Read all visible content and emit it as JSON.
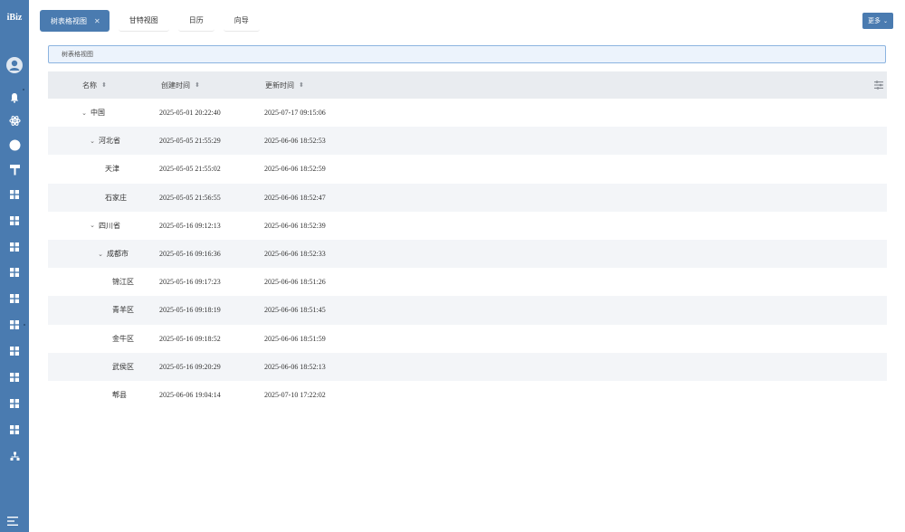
{
  "sidebar": {
    "brand": "iBiz",
    "icons": [
      "user-avatar-icon",
      "bell-icon",
      "atom-icon",
      "circle-icon",
      "hammer-icon",
      "grid-icon",
      "grid-icon",
      "grid-icon",
      "grid-icon",
      "grid-icon",
      "grid-icon",
      "grid-icon",
      "grid-icon",
      "grid-icon",
      "grid-icon",
      "sitemap-icon",
      "menu-toggle-icon"
    ]
  },
  "tabs": [
    {
      "label": "树表格视图",
      "active": true,
      "closable": true
    },
    {
      "label": "甘特视图",
      "active": false
    },
    {
      "label": "日历",
      "active": false
    },
    {
      "label": "向导",
      "active": false
    }
  ],
  "toolbar": {
    "more_label": "更多"
  },
  "breadcrumb": {
    "label": "树表格视图"
  },
  "grid": {
    "columns": {
      "name": "名称",
      "created": "创建时间",
      "updated": "更新时间"
    },
    "rows": [
      {
        "name": "中国",
        "expanded": true,
        "level": 0,
        "has_children": true,
        "created": "2025-05-01 20:22:40",
        "updated": "2025-07-17 09:15:06"
      },
      {
        "name": "河北省",
        "expanded": true,
        "level": 1,
        "has_children": true,
        "created": "2025-05-05 21:55:29",
        "updated": "2025-06-06 18:52:53"
      },
      {
        "name": "天津",
        "level": 2,
        "has_children": false,
        "created": "2025-05-05 21:55:02",
        "updated": "2025-06-06 18:52:59"
      },
      {
        "name": "石家庄",
        "level": 2,
        "has_children": false,
        "created": "2025-05-05 21:56:55",
        "updated": "2025-06-06 18:52:47"
      },
      {
        "name": "四川省",
        "expanded": true,
        "level": 1,
        "has_children": true,
        "created": "2025-05-16 09:12:13",
        "updated": "2025-06-06 18:52:39"
      },
      {
        "name": "成都市",
        "expanded": true,
        "level": 2,
        "has_children": true,
        "created": "2025-05-16 09:16:36",
        "updated": "2025-06-06 18:52:33"
      },
      {
        "name": "锦江区",
        "level": 3,
        "has_children": false,
        "created": "2025-05-16 09:17:23",
        "updated": "2025-06-06 18:51:26"
      },
      {
        "name": "青羊区",
        "level": 3,
        "has_children": false,
        "created": "2025-05-16 09:18:19",
        "updated": "2025-06-06 18:51:45"
      },
      {
        "name": "金牛区",
        "level": 3,
        "has_children": false,
        "created": "2025-05-16 09:18:52",
        "updated": "2025-06-06 18:51:59"
      },
      {
        "name": "武侯区",
        "level": 3,
        "has_children": false,
        "created": "2025-05-16 09:20:29",
        "updated": "2025-06-06 18:52:13"
      },
      {
        "name": "郫县",
        "level": 3,
        "has_children": false,
        "created": "2025-06-06 19:04:14",
        "updated": "2025-07-10 17:22:02"
      }
    ]
  },
  "colors": {
    "accent": "#4a7bb0",
    "header_bg": "#e9ecf0",
    "breadcrumb_bg": "#ecf3fc",
    "breadcrumb_border": "#8cb4e0",
    "stripe": "#f3f5f8"
  }
}
